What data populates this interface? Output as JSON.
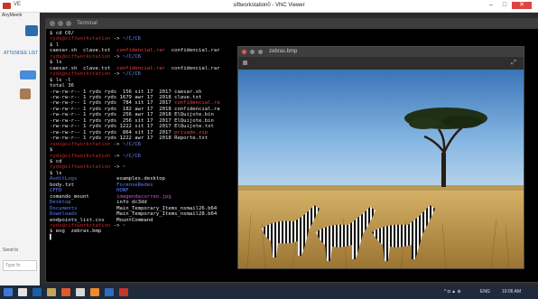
{
  "vnc": {
    "app_label": "VE",
    "title": "siftworkstation0 - VNC Viewer",
    "minimize": "–",
    "maximize": "□",
    "close": "✕"
  },
  "left_app": {
    "name": "AnyMeetir",
    "attendee_label": "ATTENDEE LIST",
    "send_label": "Send to",
    "type_placeholder": "Type fo"
  },
  "terminal": {
    "title": "Terminal",
    "lines": [
      {
        "t": "$ cd C6/"
      },
      {
        "segments": [
          {
            "c": "prompt",
            "t": "ryds@siftworkstation"
          },
          {
            "c": "",
            "t": " -> "
          },
          {
            "c": "path",
            "t": "~/C/C6"
          }
        ]
      },
      {
        "t": "$ l"
      },
      {
        "segments": [
          {
            "c": "",
            "t": "caesar.sh  clave.txt  "
          },
          {
            "c": "red",
            "t": "confidencial.rar"
          },
          {
            "c": "",
            "t": "  confidencial.rar"
          }
        ]
      },
      {
        "segments": [
          {
            "c": "prompt",
            "t": "ryds@siftworkstation"
          },
          {
            "c": "",
            "t": " -> "
          },
          {
            "c": "path",
            "t": "~/C/C6"
          }
        ]
      },
      {
        "t": "$ ls"
      },
      {
        "segments": [
          {
            "c": "",
            "t": "caesar.sh  clave.txt  "
          },
          {
            "c": "red",
            "t": "confidencial.rar"
          },
          {
            "c": "",
            "t": "  confidencial.rar"
          }
        ]
      },
      {
        "segments": [
          {
            "c": "prompt",
            "t": "ryds@siftworkstation"
          },
          {
            "c": "",
            "t": " -> "
          },
          {
            "c": "path",
            "t": "~/C/C6"
          }
        ]
      },
      {
        "t": "$ ls -l"
      },
      {
        "t": "total 36"
      },
      {
        "t": "-rw-rw-r-- 1 ryds ryds  156 sit 17  2017 caesar.sh"
      },
      {
        "t": "-rw-rw-r-- 1 ryds ryds 1679 awr 17  2018 clave.txt"
      },
      {
        "segments": [
          {
            "c": "",
            "t": "-rw-rw-r-- 1 ryds ryds  784 sit 17  2017 "
          },
          {
            "c": "red",
            "t": "confidencial.ra"
          }
        ]
      },
      {
        "t": "-rw-rw-r-- 1 ryds ryds  182 awr 17  2018 confidencial.ra"
      },
      {
        "t": "-rw-rw-r-- 1 ryds ryds  256 awr 17  2018 ElQuijote.bin"
      },
      {
        "t": "-rw-rw-r-- 1 ryds ryds  256 sit 17  2017 ElQuijote.bin"
      },
      {
        "t": "-rw-rw-r-- 1 ryds ryds 1222 sit 17  2017 ElQuijote.txt"
      },
      {
        "segments": [
          {
            "c": "",
            "t": "-rw-rw-r-- 1 ryds ryds  864 sit 17  2017 "
          },
          {
            "c": "red",
            "t": "privado.zip"
          }
        ]
      },
      {
        "t": "-rw-rw-r-- 1 ryds ryds 1222 awr 17  2018 Reporte.txt"
      },
      {
        "segments": [
          {
            "c": "prompt",
            "t": "ryds@siftworkstation"
          },
          {
            "c": "",
            "t": " -> "
          },
          {
            "c": "path",
            "t": "~/C/C6"
          }
        ]
      },
      {
        "t": "$"
      },
      {
        "segments": [
          {
            "c": "prompt",
            "t": "ryds@siftworkstation"
          },
          {
            "c": "",
            "t": " -> "
          },
          {
            "c": "path",
            "t": "~/C/C6"
          }
        ]
      },
      {
        "t": "$ cd"
      },
      {
        "segments": [
          {
            "c": "prompt",
            "t": "ryds@siftworkstation"
          },
          {
            "c": "",
            "t": " -> "
          },
          {
            "c": "path",
            "t": "~"
          }
        ]
      },
      {
        "t": "$ ls"
      },
      {
        "segments": [
          {
            "c": "blue",
            "t": "AuditLogs"
          },
          {
            "c": "",
            "t": "             examples.desktop                            "
          },
          {
            "c": "blue",
            "t": "M"
          }
        ]
      },
      {
        "segments": [
          {
            "c": "",
            "t": "body.txt              "
          },
          {
            "c": "blue",
            "t": "ForenseRedes"
          },
          {
            "c": "",
            "t": "                                "
          },
          {
            "c": "blue",
            "t": "o"
          }
        ]
      },
      {
        "segments": [
          {
            "c": "blue",
            "t": "CFFD"
          },
          {
            "c": "",
            "t": "                  "
          },
          {
            "c": "blue",
            "t": "HONF"
          },
          {
            "c": "",
            "t": "                                        "
          },
          {
            "c": "blue",
            "t": "p"
          }
        ]
      },
      {
        "segments": [
          {
            "c": "",
            "t": "comando_mount         "
          },
          {
            "c": "mag",
            "t": "imagendecorreo.jpg"
          },
          {
            "c": "",
            "t": "                          "
          },
          {
            "c": "blue",
            "t": "p"
          }
        ]
      },
      {
        "segments": [
          {
            "c": "blue",
            "t": "Desktop"
          },
          {
            "c": "",
            "t": "               info dc3dd                                  "
          },
          {
            "c": "blue",
            "t": "p"
          }
        ]
      },
      {
        "segments": [
          {
            "c": "blue",
            "t": "Documents"
          },
          {
            "c": "",
            "t": "             Main_Temporary_Items_nsmail26.b64           "
          },
          {
            "c": "blue",
            "t": "P"
          }
        ]
      },
      {
        "segments": [
          {
            "c": "blue",
            "t": "Downloads"
          },
          {
            "c": "",
            "t": "             Main_Temporary_Items_nsmail28.b64           "
          },
          {
            "c": "red",
            "t": "d"
          }
        ]
      },
      {
        "t": "endpoints_list.csv    MountCommand                                q"
      },
      {
        "segments": [
          {
            "c": "prompt",
            "t": "ryds@siftworkstation"
          },
          {
            "c": "",
            "t": " -> "
          },
          {
            "c": "path",
            "t": "~"
          }
        ]
      },
      {
        "t": "$ eog  zebras.bmp"
      },
      {
        "t": "▌"
      }
    ]
  },
  "viewer": {
    "title": "zebras.bmp",
    "image_alt": "zebras under acacia tree"
  },
  "taskbar": {
    "lang": "ENG",
    "time": "10:06 AM"
  },
  "colors": {
    "terminal_bg": "#000000",
    "prompt": "#cc2626",
    "path": "#6b8cff",
    "taskbar": "#1f2a3a"
  }
}
